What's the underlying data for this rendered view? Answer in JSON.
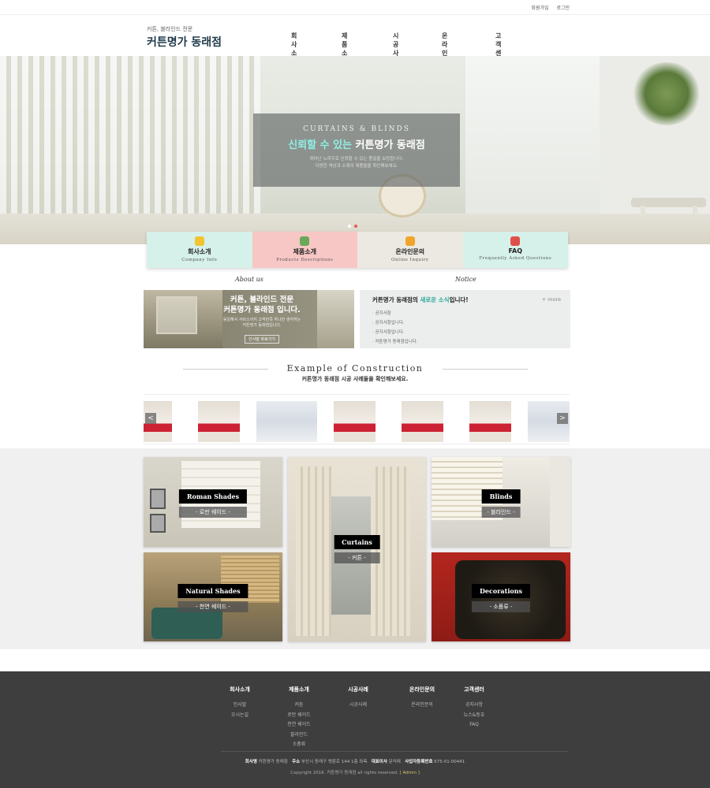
{
  "topbar": {
    "join": "회원가입",
    "login": "로그인"
  },
  "logo": {
    "tagline": "커튼, 블라인드 전문",
    "name": "커튼명가 동래점"
  },
  "nav": [
    "회사소개",
    "제품소개",
    "시공사례",
    "온라인문의",
    "고객센터"
  ],
  "hero": {
    "en": "CURTAINS & BLINDS",
    "ko_highlight": "신뢰할 수 있는",
    "ko_rest": "커튼명가 동래점",
    "desc1": "뛰어난 노하우로 신뢰할 수 있는 품질을 보장합니다.",
    "desc2": "다양한 색상과 소재의 제품들을 확인해보세요."
  },
  "quick": [
    {
      "title": "회사소개",
      "sub": "Company Info",
      "color": "#d6f1ea",
      "icon": "lightbulb-icon",
      "icon_color": "#f2c430"
    },
    {
      "title": "제품소개",
      "sub": "Products Descriptions",
      "color": "#f7c7c5",
      "icon": "catalog-icon",
      "icon_color": "#6aa85a"
    },
    {
      "title": "온라인문의",
      "sub": "Online Inquiry",
      "color": "#ece9e2",
      "icon": "chat-icon",
      "icon_color": "#f0a52a"
    },
    {
      "title": "FAQ",
      "sub": "Frequently Asked Questions",
      "color": "#d6f1ea",
      "icon": "faq-icon",
      "icon_color": "#e0504a"
    }
  ],
  "about": {
    "section_title": "About us",
    "headline1": "커튼, 블라인드 전문",
    "headline2": "커튼명가 동래점 입니다.",
    "text1": "동일해서 서비스까지 고객만족 하나만 생각하는",
    "text2": "커튼명가 동래점입니다.",
    "button": "인사말 바로가기"
  },
  "notice": {
    "section_title": "Notice",
    "head_pre": "커튼명가 동래점의",
    "head_hl": "새로운 소식",
    "head_post": "입니다!",
    "more": "+ more",
    "items": [
      "· 공지사항",
      "· 공지사항입니다.",
      "· 공지사항입니다.",
      "· 커튼명가 동래점입니다."
    ]
  },
  "examples": {
    "title": "Example of Construction",
    "subtitle": "커튼명가 동래점 시공 사례들을 확인해보세요.",
    "prev": "<",
    "next": ">"
  },
  "products": [
    {
      "en": "Roman Shades",
      "ko": "- 로만 쉐이드 -"
    },
    {
      "en": "Curtains",
      "ko": "- 커튼 -"
    },
    {
      "en": "Blinds",
      "ko": "- 블라인드 -"
    },
    {
      "en": "Natural Shades",
      "ko": "- 천연 쉐이드 -"
    },
    {
      "en": "Decorations",
      "ko": "- 소품류 -"
    }
  ],
  "footer": {
    "cols": [
      {
        "head": "회사소개",
        "items": [
          "인사말",
          "오시는길"
        ]
      },
      {
        "head": "제품소개",
        "items": [
          "커튼",
          "로만 쉐이드",
          "천연 쉐이드",
          "블라인드",
          "소품류"
        ]
      },
      {
        "head": "시공사례",
        "items": [
          "시공사례"
        ]
      },
      {
        "head": "온라인문의",
        "items": [
          "온라인문의"
        ]
      },
      {
        "head": "고객센터",
        "items": [
          "공지사항",
          "뉴스&동호",
          "FAQ"
        ]
      }
    ],
    "company_label": "회사명",
    "company": "커튼명가 동래점",
    "address_label": "주소",
    "address": "부산시 동래구 명륜로 144 1층 좌측",
    "ceo_label": "대표이사",
    "ceo": "문익태",
    "bizno_label": "사업자등록번호",
    "bizno": "675-01-00441",
    "copyright": "Copyright 2016. 커튼명가 동래점 all rights reserved.",
    "admin": "[ Admin ]"
  }
}
